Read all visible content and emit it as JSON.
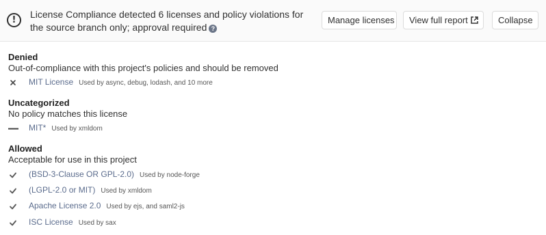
{
  "header": {
    "summary": "License Compliance detected 6 licenses and policy violations for the source branch only; approval required",
    "alert_icon": "exclamation-circle-icon",
    "help_icon": "question-circle-icon",
    "buttons": {
      "manage": "Manage licenses",
      "report": "View full report",
      "collapse": "Collapse"
    }
  },
  "sections": {
    "denied": {
      "title": "Denied",
      "description": "Out-of-compliance with this project's policies and should be removed",
      "items": [
        {
          "name": "MIT License",
          "usage": "Used by async, debug, lodash, and 10 more",
          "icon": "close-icon"
        }
      ]
    },
    "uncategorized": {
      "title": "Uncategorized",
      "description": "No policy matches this license",
      "items": [
        {
          "name": "MIT*",
          "usage": "Used by xmldom",
          "icon": "dash-icon"
        }
      ]
    },
    "allowed": {
      "title": "Allowed",
      "description": "Acceptable for use in this project",
      "items": [
        {
          "name": "(BSD-3-Clause OR GPL-2.0)",
          "usage": "Used by node-forge",
          "icon": "check-icon"
        },
        {
          "name": "(LGPL-2.0 or MIT)",
          "usage": "Used by xmldom",
          "icon": "check-icon"
        },
        {
          "name": "Apache License 2.0",
          "usage": "Used by ejs, and saml2-js",
          "icon": "check-icon"
        },
        {
          "name": "ISC License",
          "usage": "Used by sax",
          "icon": "check-icon"
        }
      ]
    }
  }
}
